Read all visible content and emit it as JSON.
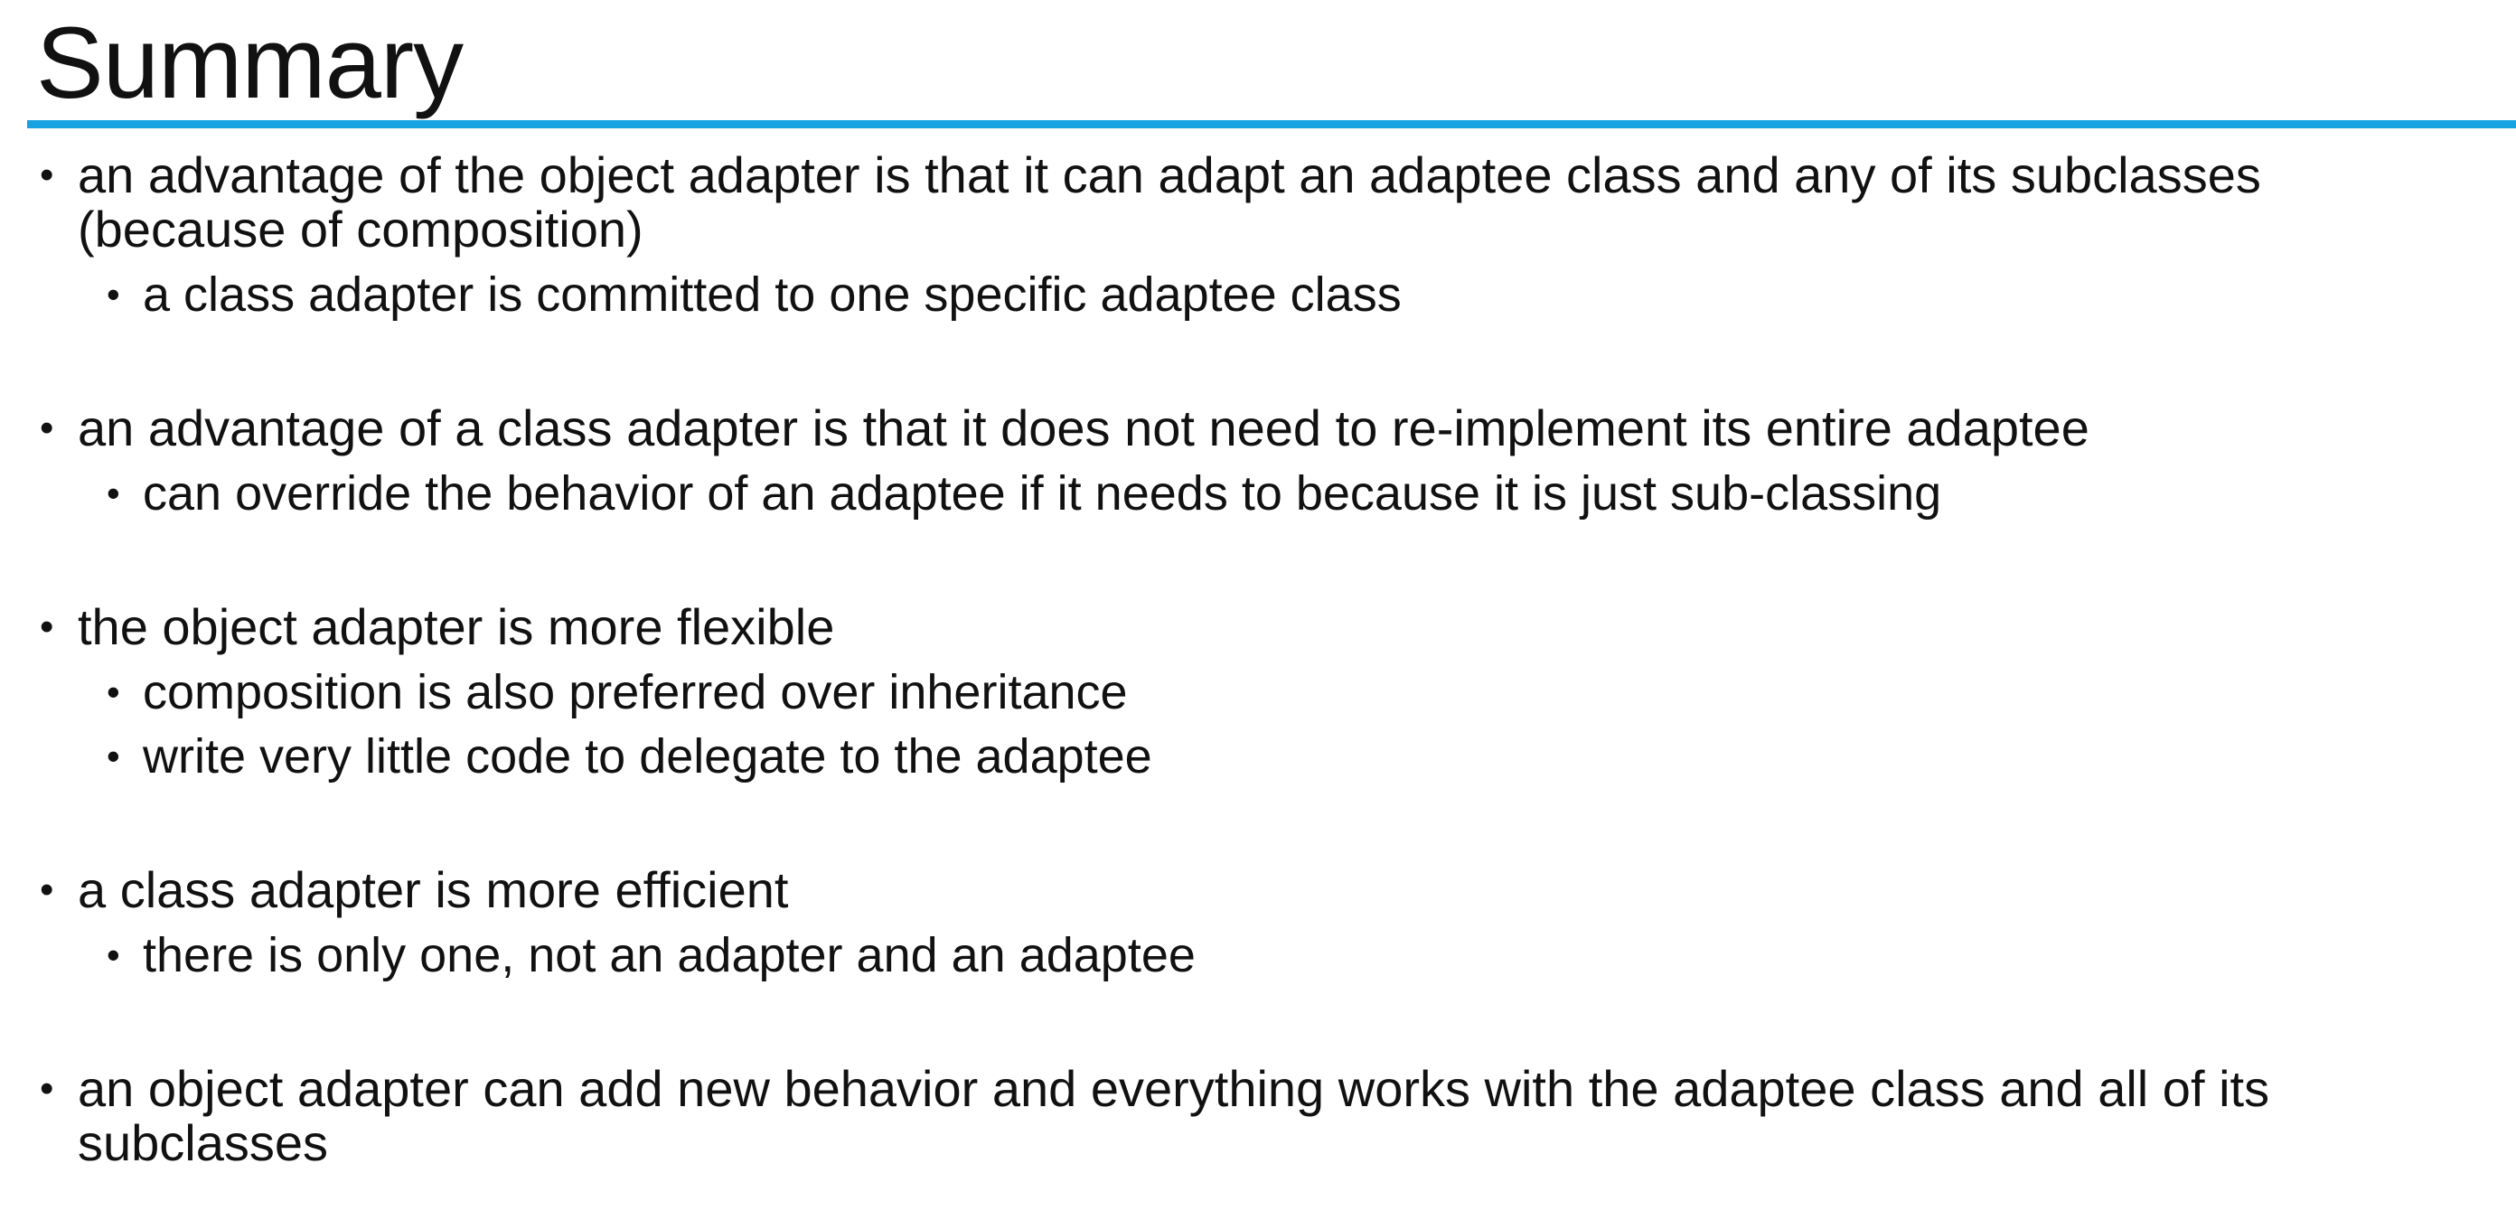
{
  "title": "Summary",
  "accent_color": "#17a2e1",
  "bullets": [
    {
      "text": "an advantage of the object adapter is that it can adapt an adaptee class and any of its subclasses (because of composition)",
      "sub": [
        "a class adapter is committed to one specific adaptee class"
      ]
    },
    {
      "text": "an advantage of a class adapter is that it does not need to re-implement its entire adaptee",
      "sub": [
        "can override the behavior of an adaptee if it needs to because it is just sub-classing"
      ]
    },
    {
      "text": "the object adapter is more flexible",
      "sub": [
        "composition is also preferred over inheritance",
        "write very little code to delegate to the adaptee"
      ]
    },
    {
      "text": "a class adapter is more efficient",
      "sub": [
        "there is only one, not an adapter and an adaptee"
      ]
    },
    {
      "text": "an object adapter can add new behavior and everything works with the adaptee class and all of its subclasses",
      "sub": []
    }
  ]
}
